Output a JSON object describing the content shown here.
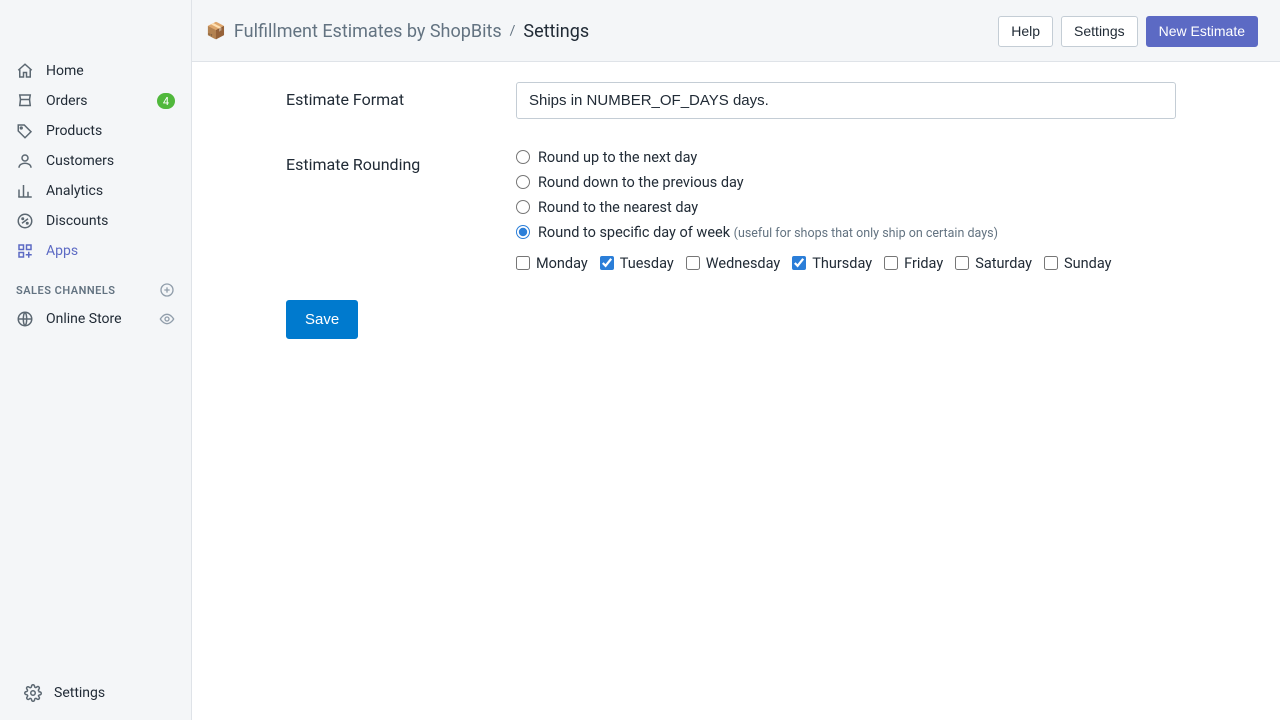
{
  "sidebar": {
    "items": [
      {
        "label": "Home"
      },
      {
        "label": "Orders",
        "badge": "4"
      },
      {
        "label": "Products"
      },
      {
        "label": "Customers"
      },
      {
        "label": "Analytics"
      },
      {
        "label": "Discounts"
      },
      {
        "label": "Apps"
      }
    ],
    "section_label": "SALES CHANNELS",
    "channels": [
      {
        "label": "Online Store"
      }
    ],
    "footer": {
      "label": "Settings"
    }
  },
  "topbar": {
    "app_name": "Fulfillment Estimates by ShopBits",
    "separator": "/",
    "current": "Settings",
    "actions": {
      "help": "Help",
      "settings": "Settings",
      "new_estimate": "New Estimate"
    }
  },
  "form": {
    "format_label": "Estimate Format",
    "format_value": "Ships in NUMBER_OF_DAYS days.",
    "rounding_label": "Estimate Rounding",
    "rounding_options": [
      "Round up to the next day",
      "Round down to the previous day",
      "Round to the nearest day",
      "Round to specific day of week"
    ],
    "rounding_hint": "(useful for shops that only ship on certain days)",
    "rounding_selected_index": 3,
    "days": [
      {
        "label": "Monday",
        "checked": false
      },
      {
        "label": "Tuesday",
        "checked": true
      },
      {
        "label": "Wednesday",
        "checked": false
      },
      {
        "label": "Thursday",
        "checked": true
      },
      {
        "label": "Friday",
        "checked": false
      },
      {
        "label": "Saturday",
        "checked": false
      },
      {
        "label": "Sunday",
        "checked": false
      }
    ],
    "save_label": "Save"
  }
}
